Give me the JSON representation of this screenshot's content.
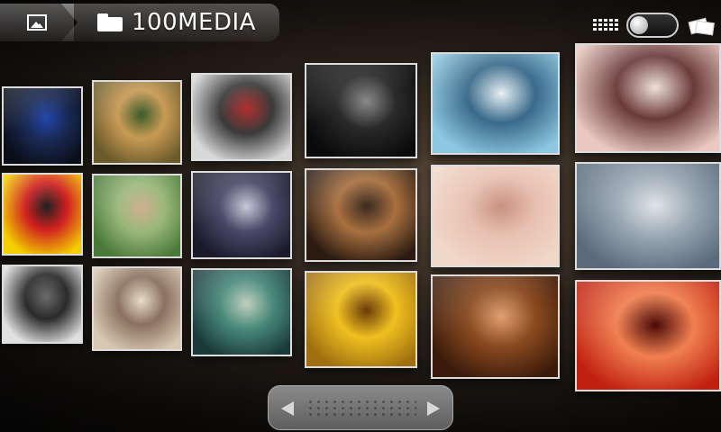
{
  "breadcrumb": {
    "home_icon": "gallery-icon",
    "folder_icon": "folder-icon",
    "title": "100MEDIA"
  },
  "toolbar": {
    "grid_view_icon": "grid-icon",
    "view_toggle": {
      "state": "off"
    },
    "slideshow_icon": "stack-icon"
  },
  "thumbnails": [
    {
      "id": "t1",
      "colors": [
        "#0a0e18",
        "#1a2a55",
        "#2245aa"
      ]
    },
    {
      "id": "t2",
      "colors": [
        "#6b5a2a",
        "#c89a55",
        "#3a5a2a"
      ]
    },
    {
      "id": "t3",
      "colors": [
        "#d8d8d8",
        "#3a3a3a",
        "#b03030"
      ]
    },
    {
      "id": "t4",
      "colors": [
        "#0a0a0a",
        "#2a2a2a",
        "#8a8a8a"
      ]
    },
    {
      "id": "t5",
      "colors": [
        "#8ec8e0",
        "#3a6a8a",
        "#e8f0f4"
      ]
    },
    {
      "id": "t6",
      "colors": [
        "#e8c8c0",
        "#6a3a3a",
        "#f0e0d8"
      ]
    },
    {
      "id": "t7",
      "colors": [
        "#f4d000",
        "#d02020",
        "#202020"
      ]
    },
    {
      "id": "t8",
      "colors": [
        "#4a7a3a",
        "#9ab87a",
        "#d0b090"
      ]
    },
    {
      "id": "t9",
      "colors": [
        "#1a1a2a",
        "#4a4a6a",
        "#c8c8d8"
      ]
    },
    {
      "id": "t10",
      "colors": [
        "#2a1a10",
        "#a87040",
        "#3a2a20"
      ]
    },
    {
      "id": "t11",
      "colors": [
        "#f0d8c8",
        "#e8c0b0",
        "#c89080"
      ]
    },
    {
      "id": "t12",
      "colors": [
        "#5a6a7a",
        "#9aa8b4",
        "#e0e4e8"
      ]
    },
    {
      "id": "t13",
      "colors": [
        "#e0e0e0",
        "#2a2a2a",
        "#6a6a6a"
      ]
    },
    {
      "id": "t14",
      "colors": [
        "#d8c8b0",
        "#8a7060",
        "#e8dcc8"
      ]
    },
    {
      "id": "t15",
      "colors": [
        "#1a3a3a",
        "#4a8a7a",
        "#c0d0c0"
      ]
    },
    {
      "id": "t16",
      "colors": [
        "#a07010",
        "#f0c020",
        "#6a3a08"
      ]
    },
    {
      "id": "t17",
      "colors": [
        "#3a1a0a",
        "#8a4a20",
        "#e0a070"
      ]
    },
    {
      "id": "t18",
      "colors": [
        "#c02010",
        "#f08050",
        "#4a0a08"
      ]
    }
  ],
  "scroller": {
    "left_icon": "arrow-left-icon",
    "right_icon": "arrow-right-icon"
  }
}
